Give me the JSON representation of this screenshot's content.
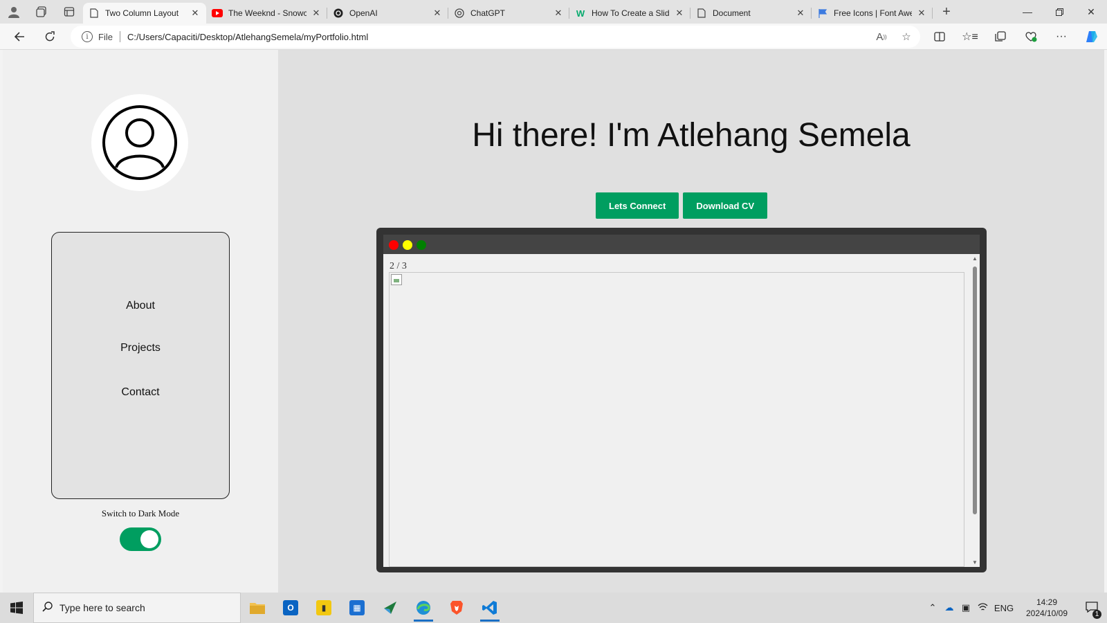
{
  "browser": {
    "tabs": [
      {
        "title": "Two Column Layout",
        "active": true
      },
      {
        "title": "The Weeknd - Snowch",
        "active": false
      },
      {
        "title": "OpenAI",
        "active": false
      },
      {
        "title": "ChatGPT",
        "active": false
      },
      {
        "title": "How To Create a Slide",
        "active": false
      },
      {
        "title": "Document",
        "active": false
      },
      {
        "title": "Free Icons | Font Awe",
        "active": false
      }
    ],
    "address": {
      "scheme_label": "File",
      "url": "C:/Users/Capaciti/Desktop/AtlehangSemela/myPortfolio.html"
    }
  },
  "sidebar": {
    "nav": [
      "About",
      "Projects",
      "Contact"
    ],
    "dark_mode_label": "Switch to Dark Mode",
    "dark_mode_on": true
  },
  "main": {
    "heading": "Hi there! I'm Atlehang Semela",
    "buttons": [
      "Lets Connect",
      "Download CV"
    ],
    "slideshow": {
      "counter": "2 / 3"
    }
  },
  "taskbar": {
    "search_placeholder": "Type here to search",
    "language": "ENG",
    "time": "14:29",
    "date": "2024/10/09",
    "notifications": "1"
  },
  "colors": {
    "accent": "#009e60",
    "dot_close": "#ff0000",
    "dot_min": "#ffff00",
    "dot_max": "#008000"
  }
}
